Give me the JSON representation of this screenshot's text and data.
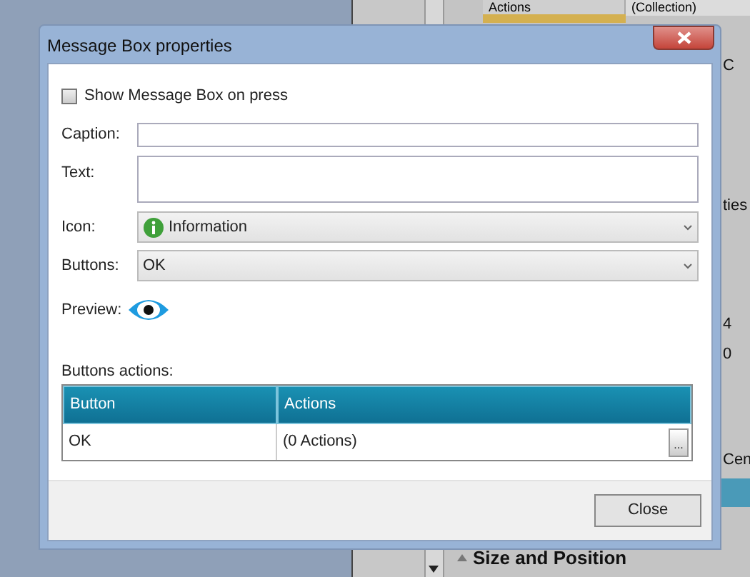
{
  "background": {
    "grid_rows": [
      {
        "name": "Actions",
        "value": "(Collection)"
      }
    ],
    "side_texts": [
      "C",
      "ties",
      "4",
      "0",
      "Cen"
    ],
    "section": "Size and Position"
  },
  "dialog": {
    "title": "Message Box properties",
    "show_on_press": {
      "label": "Show Message Box on press",
      "checked": false
    },
    "caption": {
      "label": "Caption:"
    },
    "text": {
      "label": "Text:"
    },
    "icon": {
      "label": "Icon:",
      "value": "Information"
    },
    "buttons": {
      "label": "Buttons:",
      "value": "OK"
    },
    "preview": {
      "label": "Preview:"
    },
    "actions_label": "Buttons actions:",
    "table": {
      "columns": [
        "Button",
        "Actions"
      ],
      "rows": [
        {
          "button": "OK",
          "actions": "(0 Actions)",
          "more": "..."
        }
      ]
    },
    "close": "Close"
  }
}
